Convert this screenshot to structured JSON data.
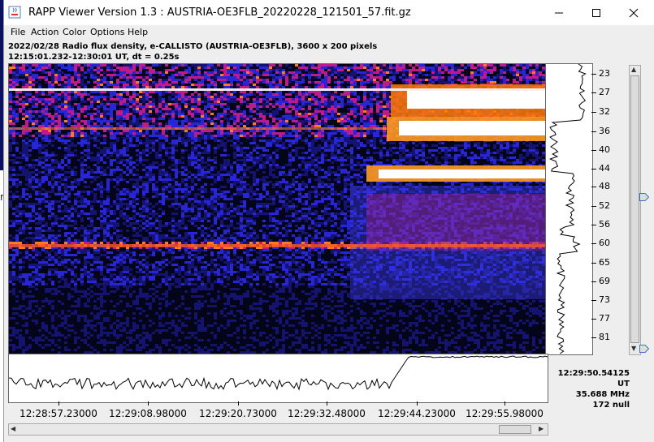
{
  "window": {
    "title": "RAPP Viewer Version 1.3 : AUSTRIA-OE3FLB_20220228_121501_57.fit.gz",
    "controls": [
      "minimize",
      "maximize",
      "close"
    ]
  },
  "menu": [
    "File",
    "Action",
    "Color",
    "Options",
    "Help"
  ],
  "info": {
    "line1": "2022/02/28  Radio flux density, e-CALLISTO (AUSTRIA-OE3FLB),  3600 x 200 pixels",
    "line2": "12:15:01.232-12:30:01 UT,  dt = 0.25s"
  },
  "frequency_axis": {
    "ticks": [
      "23",
      "27",
      "32",
      "36",
      "40",
      "44",
      "48",
      "52",
      "56",
      "60",
      "65",
      "69",
      "73",
      "77",
      "81"
    ]
  },
  "time_axis": {
    "ticks": [
      "12:28:57.23000",
      "12:29:08.98000",
      "12:29:20.73000",
      "12:29:32.48000",
      "12:29:44.23000",
      "12:29:55.98000"
    ]
  },
  "readout": {
    "time": "12:29:50.54125 UT",
    "frequency": "35.688 MHz",
    "value": "172 null"
  },
  "backdrop": {
    "glyph": "r"
  },
  "colors": {
    "background": "#05051a",
    "burst": "#ffffff",
    "noise": "#2222cc",
    "hot": "#ff6a1a"
  }
}
